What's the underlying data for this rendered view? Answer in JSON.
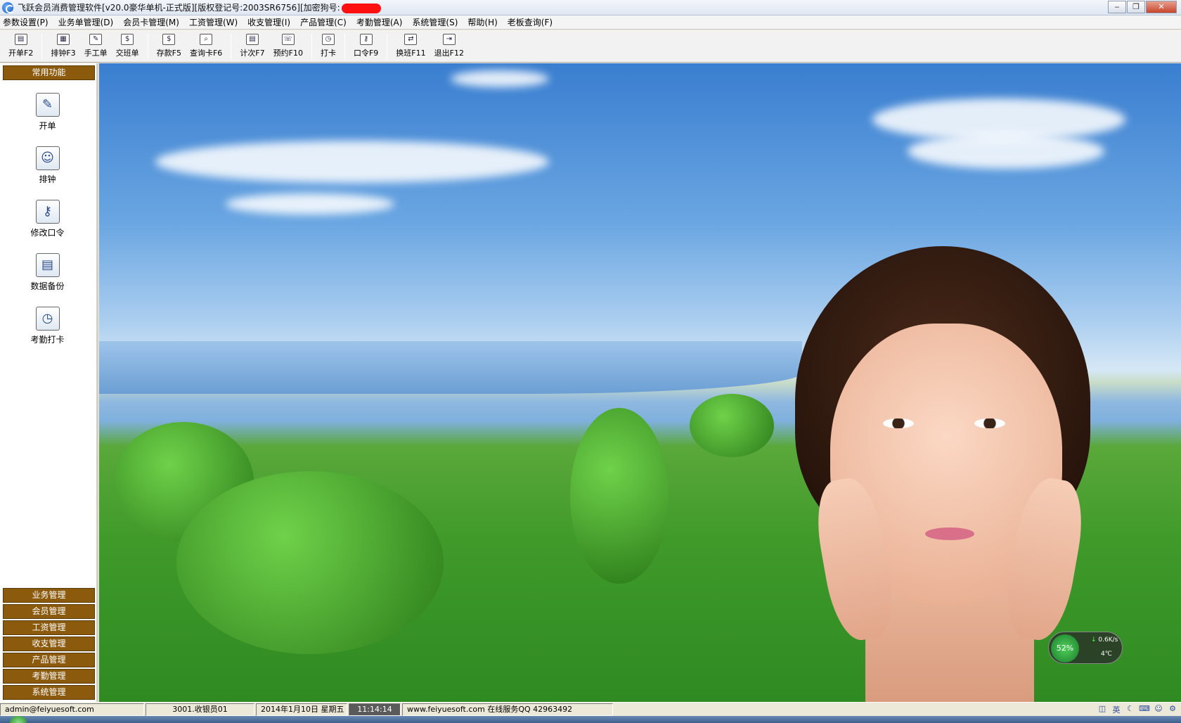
{
  "window": {
    "title": "飞跃会员消费管理软件[v20.0豪华单机-正式版][版权登记号:2003SR6756][加密狗号:",
    "minimize_label": "‒",
    "restore_label": "❐",
    "close_label": "✕"
  },
  "menubar": {
    "items": [
      "参数设置(P)",
      "业务单管理(D)",
      "会员卡管理(M)",
      "工资管理(W)",
      "收支管理(I)",
      "产品管理(C)",
      "考勤管理(A)",
      "系统管理(S)",
      "帮助(H)",
      "老板查询(F)"
    ]
  },
  "toolbar": {
    "buttons": [
      {
        "label": "开单F2",
        "icon": "▤"
      },
      {
        "label": "排钟F3",
        "icon": "▦"
      },
      {
        "label": "手工单",
        "icon": "✎"
      },
      {
        "label": "交班单",
        "icon": "$"
      },
      {
        "label": "存款F5",
        "icon": "$"
      },
      {
        "label": "查询卡F6",
        "icon": "⌕"
      },
      {
        "label": "计次F7",
        "icon": "▤"
      },
      {
        "label": "预约F10",
        "icon": "☏"
      },
      {
        "label": "打卡",
        "icon": "◷"
      },
      {
        "label": "口令F9",
        "icon": "⚷"
      },
      {
        "label": "换班F11",
        "icon": "⇄"
      },
      {
        "label": "退出F12",
        "icon": "⇥"
      }
    ]
  },
  "sidebar": {
    "header": "常用功能",
    "items": [
      {
        "label": "开单",
        "icon": "✎"
      },
      {
        "label": "排钟",
        "icon": "☺"
      },
      {
        "label": "修改口令",
        "icon": "⚷"
      },
      {
        "label": "数据备份",
        "icon": "▤"
      },
      {
        "label": "考勤打卡",
        "icon": "◷"
      }
    ],
    "sections": [
      "业务管理",
      "会员管理",
      "工资管理",
      "收支管理",
      "产品管理",
      "考勤管理",
      "系统管理"
    ]
  },
  "widget": {
    "percent": "52%",
    "net_speed": "0.6K/s",
    "temperature": "4℃"
  },
  "statusbar": {
    "email": "admin@feiyuesoft.com",
    "operator": "3001.收银员01",
    "date": "2014年1月10日  星期五",
    "time": "11:14:14",
    "website": "www.feiyuesoft.com  在线服务QQ 42963492"
  },
  "tray": {
    "icons": [
      "input-method-icon",
      "language-icon",
      "moon-icon",
      "keyboard-icon",
      "user-icon",
      "settings-icon"
    ],
    "lang_label": "英"
  }
}
